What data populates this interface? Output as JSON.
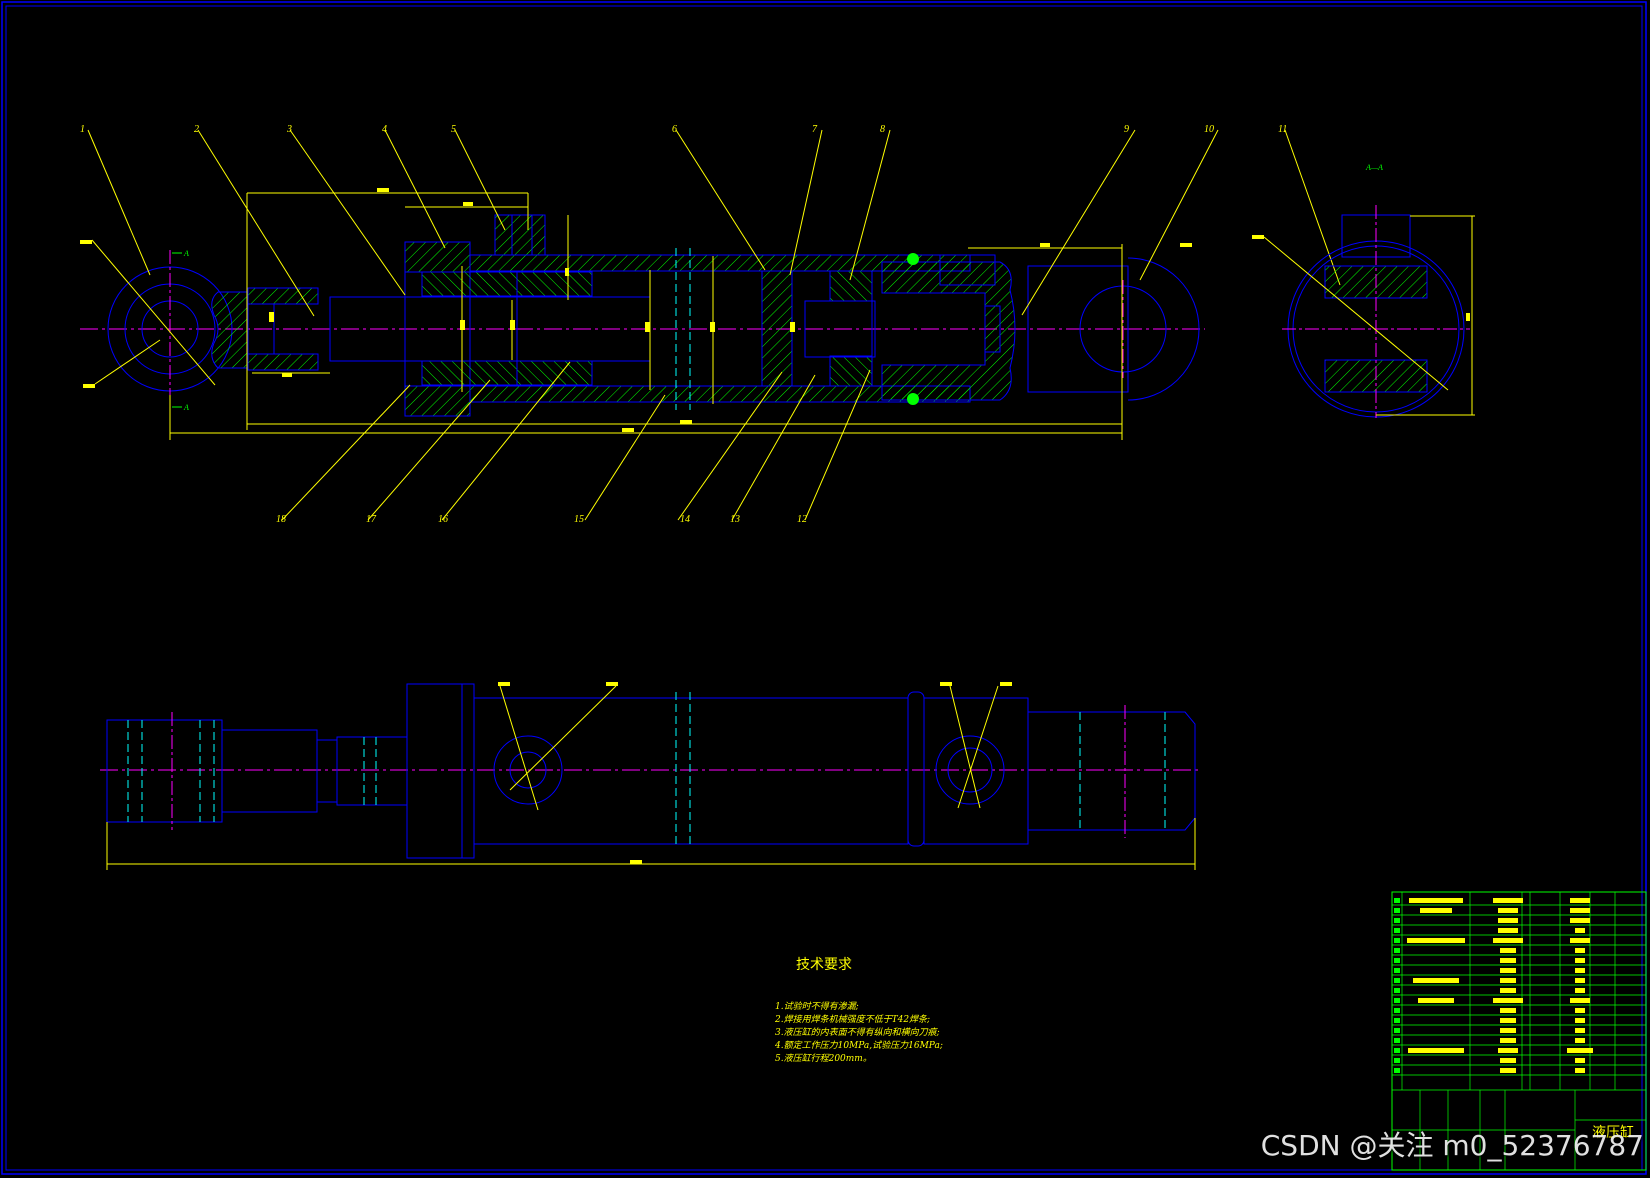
{
  "drawing": {
    "colors": {
      "background": "#000000",
      "outline": "#0000ff",
      "dimension": "#ffff00",
      "hatch": "#00ff00",
      "centerline": "#ff00ff",
      "hidden": "#00ffff"
    },
    "callouts": [
      "1",
      "2",
      "3",
      "4",
      "5",
      "6",
      "7",
      "8",
      "9",
      "10",
      "11",
      "18",
      "17",
      "16",
      "15",
      "14",
      "13",
      "12"
    ],
    "section_view_label": "A—A",
    "section_markers": [
      "A",
      "A"
    ]
  },
  "technical_requirements": {
    "title": "技术要求",
    "lines": [
      "1.试验时不得有渗漏;",
      "2.焊接用焊条机械强度不低于T42焊条;",
      "3.液压缸的内表面不得有纵向和横向刀痕;",
      "4.额定工作压力10MPa,试验压力16MPa;",
      "5.液压缸行程200mm。"
    ]
  },
  "title_block": {
    "drawing_name": "液压缸"
  },
  "watermark": "CSDN @关注 m0_52376787"
}
